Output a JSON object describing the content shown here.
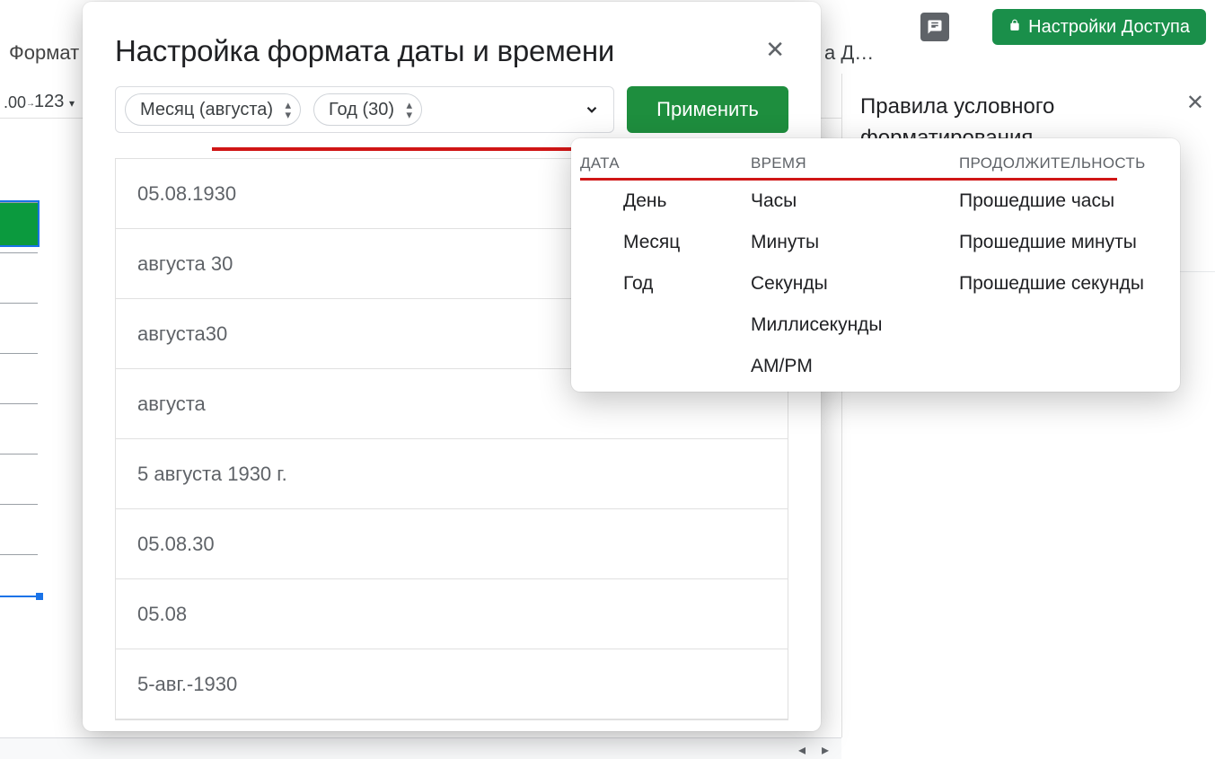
{
  "toolbar": {
    "format_menu": "Формат",
    "num_format": ".00",
    "one_two_three": "123",
    "doc_name_fragment": "а Д…"
  },
  "share_button": {
    "label": "Настройки Доступа"
  },
  "right_panel": {
    "title": "Правила условного форматирования"
  },
  "modal": {
    "title": "Настройка формата даты и времени",
    "chip_month": "Месяц (августа)",
    "chip_year": "Год (30)",
    "apply": "Применить",
    "options": [
      "05.08.1930",
      "августа 30",
      "августа30",
      "августа",
      "5 августа 1930 г.",
      "05.08.30",
      "05.08",
      "5-авг.-1930"
    ]
  },
  "popup": {
    "headers": {
      "date": "ДАТА",
      "time": "ВРЕМЯ",
      "duration": "ПРОДОЛЖИТЕЛЬНОСТЬ"
    },
    "date": [
      "День",
      "Месяц",
      "Год"
    ],
    "time": [
      "Часы",
      "Минуты",
      "Секунды",
      "Миллисекунды",
      "AM/PM"
    ],
    "duration": [
      "Прошедшие часы",
      "Прошедшие минуты",
      "Прошедшие секунды"
    ]
  }
}
